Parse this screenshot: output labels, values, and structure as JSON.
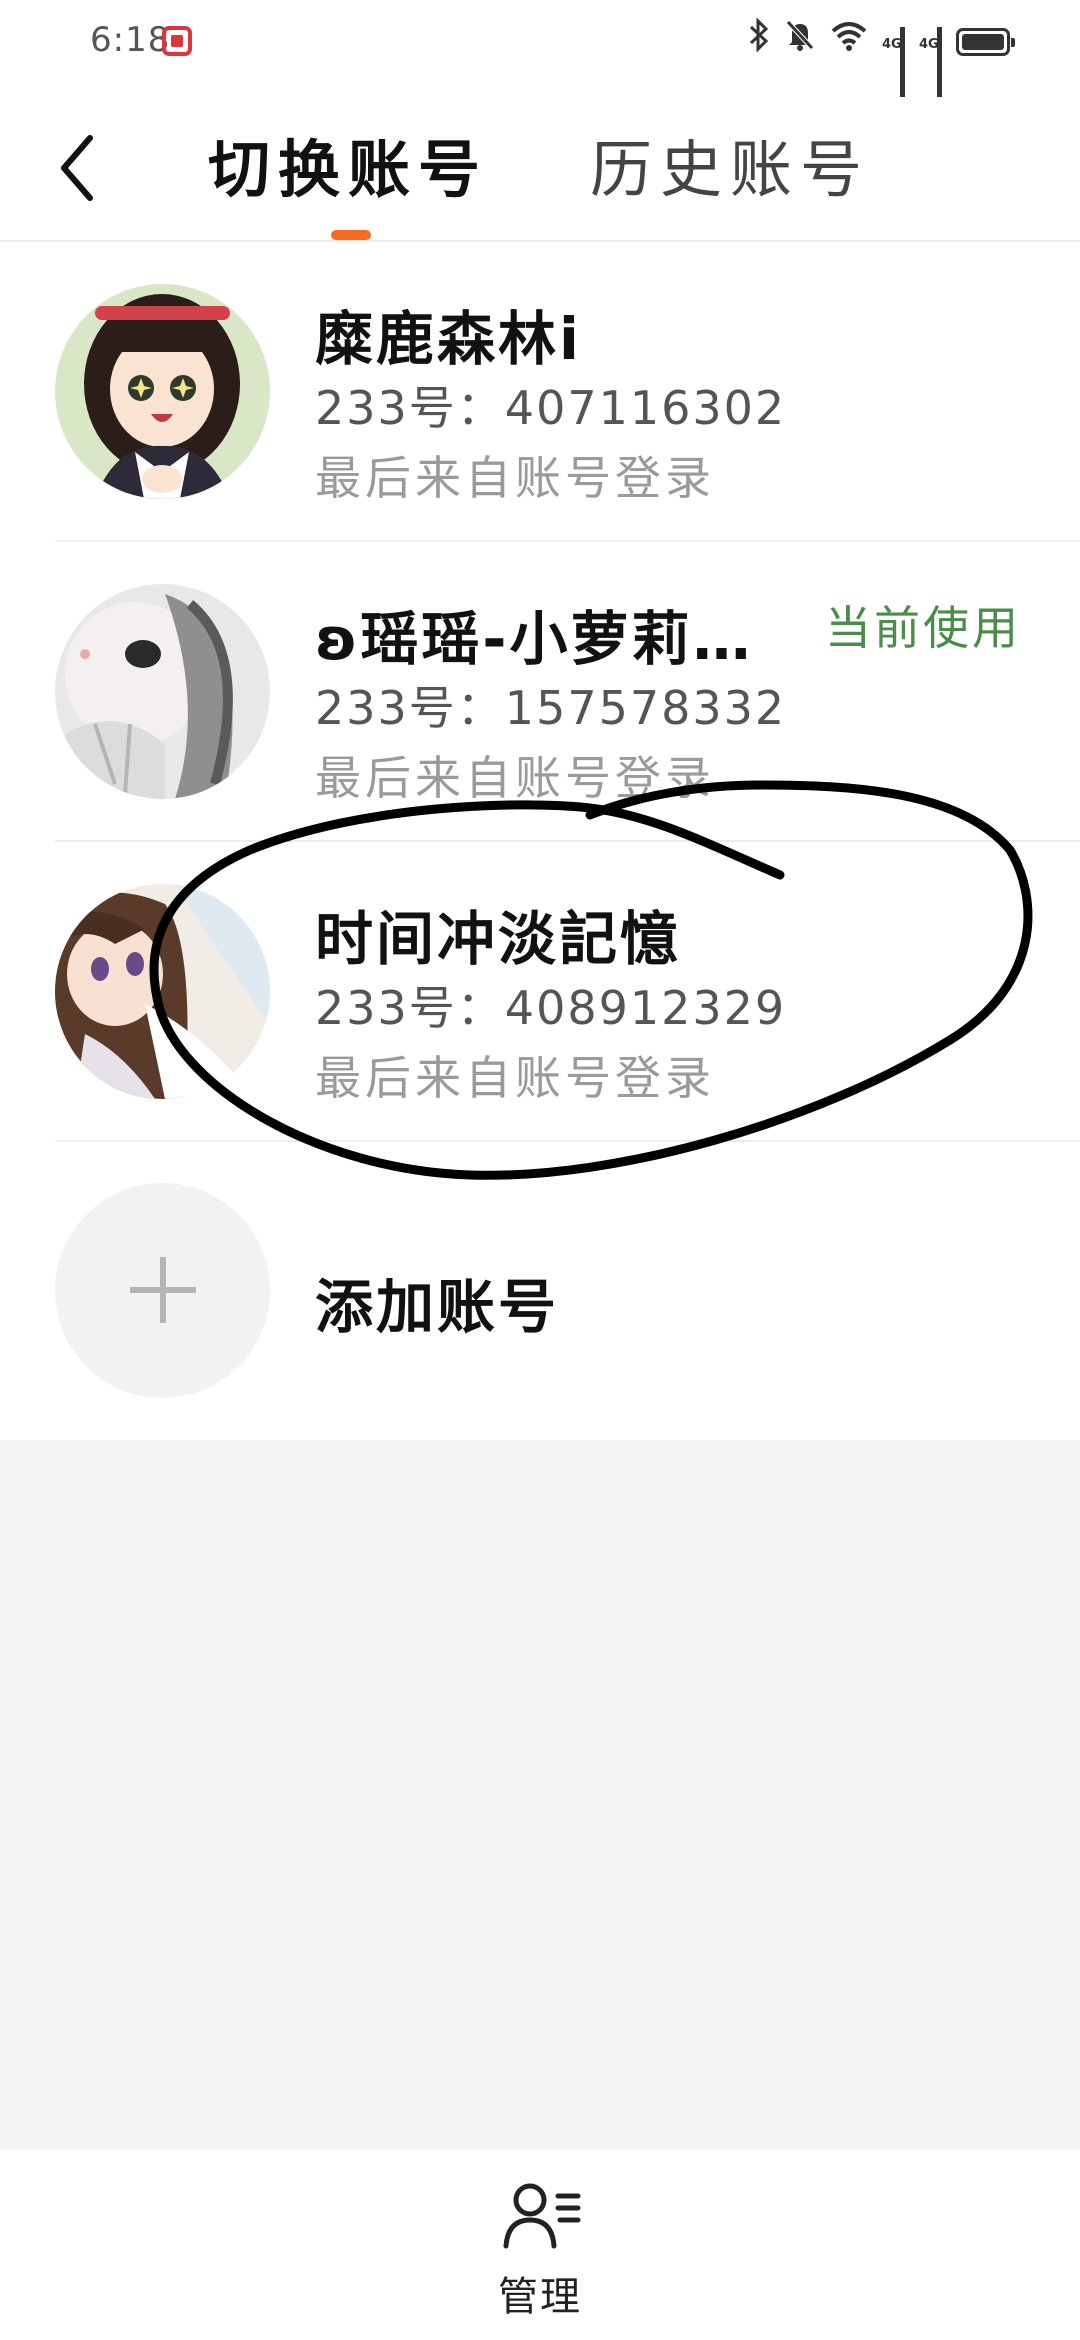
{
  "status_bar": {
    "time": "6:18",
    "network_1": "4G",
    "network_2": "4G",
    "icons": [
      "bluetooth-icon",
      "mute-bell-icon",
      "wifi-icon",
      "signal-icon",
      "signal-icon",
      "battery-icon"
    ]
  },
  "header": {
    "tabs": [
      {
        "label": "切换账号",
        "active": true
      },
      {
        "label": "历史账号",
        "active": false
      }
    ],
    "accent_color": "#f56b24"
  },
  "accounts": [
    {
      "name": "糜鹿森林i",
      "id": "233号：407116302",
      "last_login": "最后来自账号登录",
      "current": false
    },
    {
      "name": "ʚ瑶瑶-小萝莉…",
      "id": "233号：157578332",
      "last_login": "最后来自账号登录",
      "current": true,
      "badge": "当前使用"
    },
    {
      "name": "时间冲淡記憶",
      "id": "233号：408912329",
      "last_login": "最后来自账号登录",
      "current": false
    }
  ],
  "add_account": {
    "label": "添加账号"
  },
  "bottom_bar": {
    "manage_label": "管理"
  },
  "colors": {
    "current_badge": "#4a8c4a",
    "background": "#f4f4f4"
  }
}
